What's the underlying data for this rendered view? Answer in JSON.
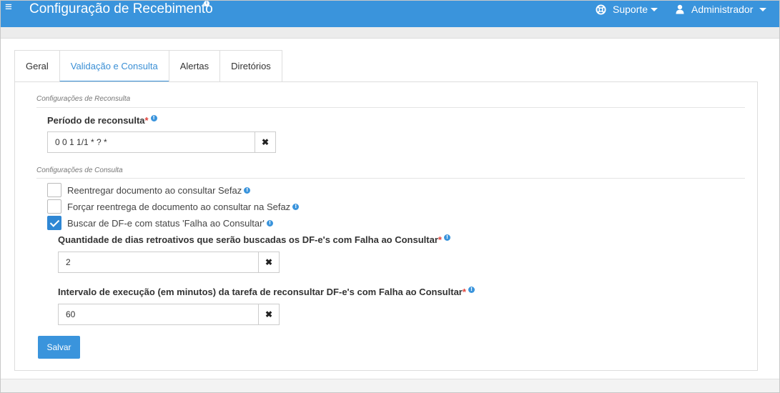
{
  "header": {
    "menu_icon": "≡",
    "title": "Configuração de Recebimento",
    "title_info_icon": "i",
    "support_label": "Suporte",
    "admin_label": "Administrador"
  },
  "tabs": [
    {
      "label": "Geral",
      "active": false
    },
    {
      "label": "Validação e Consulta",
      "active": true
    },
    {
      "label": "Alertas",
      "active": false
    },
    {
      "label": "Diretórios",
      "active": false
    }
  ],
  "reconsulta": {
    "legend": "Configurações de Reconsulta",
    "period_label": "Período de reconsulta",
    "period_value": "0 0 1 1/1 * ? *"
  },
  "consulta": {
    "legend": "Configurações de Consulta",
    "checkboxes": [
      {
        "label": "Reentregar documento ao consultar Sefaz",
        "checked": false
      },
      {
        "label": "Forçar reentrega de documento ao consultar na Sefaz",
        "checked": false
      },
      {
        "label": "Buscar de DF-e com status 'Falha ao Consultar'",
        "checked": true
      }
    ],
    "days_label": "Quantidade de dias retroativos que serão buscadas os DF-e's com Falha ao Consultar",
    "days_value": "2",
    "interval_label": "Intervalo de execução (em minutos) da tarefa de reconsultar DF-e's com Falha ao Consultar",
    "interval_value": "60"
  },
  "common": {
    "required_mark": "*",
    "info_mark": "!",
    "clear_mark": "✖"
  },
  "actions": {
    "save_label": "Salvar"
  },
  "colors": {
    "primary": "#3a94dc",
    "required": "#e0423b",
    "active_tab_text": "#3a8fd5"
  }
}
